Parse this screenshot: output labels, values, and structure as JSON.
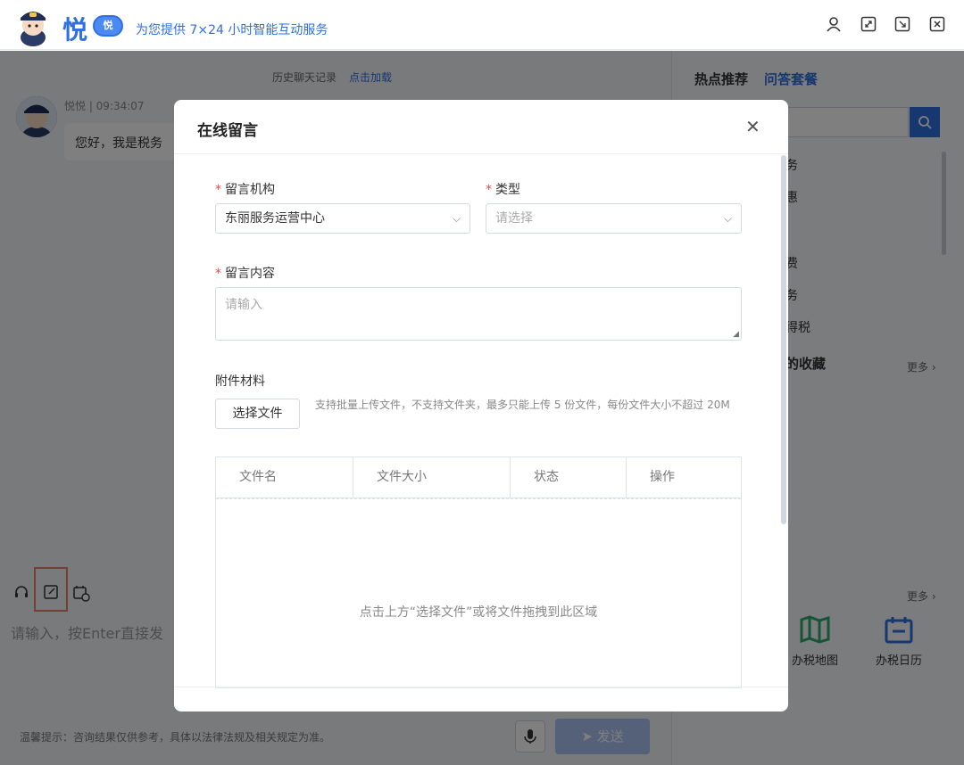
{
  "header": {
    "logo_text": "悦",
    "logo_badge": "悦",
    "slogan": "为您提供 7×24 小时智能互动服务",
    "icons": [
      "user-icon",
      "expand-icon",
      "minimize-icon",
      "close-icon"
    ]
  },
  "chat": {
    "history_label": "历史聊天记录",
    "history_link": "点击加载",
    "sender": "悦悦 | 09:34:07",
    "greeting": "您好，我是税务",
    "input_placeholder": "请输入，按Enter直接发",
    "tip": "温馨提示：咨询结果仅供参考，具体以法律法规及相关规定为准。",
    "send_label": "➤ 发送"
  },
  "right_panel": {
    "tab_hot": "热点推荐",
    "tab_package": "问答套餐",
    "items": [
      "务",
      "惠",
      "费",
      "务",
      "得税"
    ],
    "collect_title": "的收藏",
    "more1": "更多 ›",
    "more2": "更多 ›",
    "tools": [
      {
        "label": "办税地图",
        "icon": "map-icon"
      },
      {
        "label": "办税日历",
        "icon": "calendar-icon"
      }
    ]
  },
  "modal": {
    "title": "在线留言",
    "org_label": "留言机构",
    "org_value": "东丽服务运营中心",
    "type_label": "类型",
    "type_placeholder": "请选择",
    "content_label": "留言内容",
    "content_placeholder": "请输入",
    "attach_label": "附件材料",
    "select_file": "选择文件",
    "file_hint": "支持批量上传文件，不支持文件夹，最多只能上传 5 份文件，每份文件大小不超过 20M",
    "columns": [
      "文件名",
      "文件大小",
      "状态",
      "操作"
    ],
    "dropzone_text": "点击上方“选择文件”或将文件拖拽到此区域",
    "required_mark": "*"
  }
}
